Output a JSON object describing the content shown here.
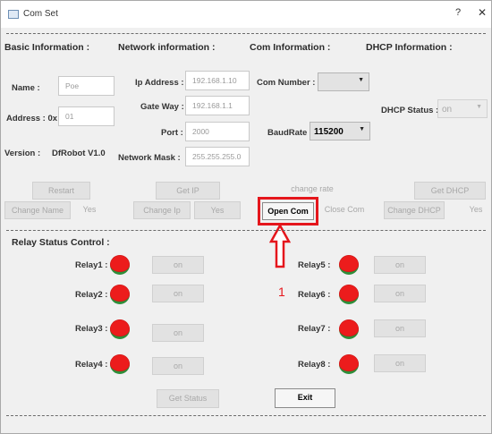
{
  "window": {
    "title": "Com Set",
    "help": "?",
    "close": "✕"
  },
  "sections": {
    "basic": "Basic Information :",
    "network": "Network information :",
    "com": "Com Information :",
    "dhcp": "DHCP Information :",
    "relay": "Relay Status Control :"
  },
  "basic": {
    "name_label": "Name :",
    "name_value": "Poe",
    "address_label": "Address : 0x",
    "address_value": "01",
    "version_label": "Version :",
    "version_value": "DfRobot V1.0",
    "restart": "Restart",
    "change_name": "Change Name",
    "yes": "Yes"
  },
  "network": {
    "ip_label": "Ip Address :",
    "ip_value": "192.168.1.10",
    "gateway_label": "Gate Way :",
    "gateway_value": "192.168.1.1",
    "port_label": "Port :",
    "port_value": "2000",
    "mask_label": "Network Mask :",
    "mask_value": "255.255.255.0",
    "get_ip": "Get IP",
    "change_ip": "Change Ip",
    "yes": "Yes"
  },
  "com": {
    "number_label": "Com Number :",
    "number_value": "",
    "baud_label": "BaudRate :",
    "baud_value": "115200",
    "change_rate": "change rate",
    "open_com": "Open Com",
    "close_com": "Close Com"
  },
  "dhcp": {
    "status_label": "DHCP Status :",
    "status_value": "on",
    "get_dhcp": "Get DHCP",
    "change_dhcp": "Change DHCP",
    "yes": "Yes"
  },
  "relays": [
    {
      "label": "Relay1 :",
      "button": "on"
    },
    {
      "label": "Relay2 :",
      "button": "on"
    },
    {
      "label": "Relay3 :",
      "button": "on"
    },
    {
      "label": "Relay4 :",
      "button": "on"
    },
    {
      "label": "Relay5 :",
      "button": "on"
    },
    {
      "label": "Relay6 :",
      "button": "on"
    },
    {
      "label": "Relay7 :",
      "button": "on"
    },
    {
      "label": "Relay8 :",
      "button": "on"
    }
  ],
  "bottom": {
    "get_status": "Get Status",
    "exit": "Exit"
  },
  "annotation": {
    "step": "1"
  },
  "colors": {
    "led_on": "#ec1c1c",
    "led_ring": "#2f8e3a",
    "annotation": "#e5161c"
  }
}
